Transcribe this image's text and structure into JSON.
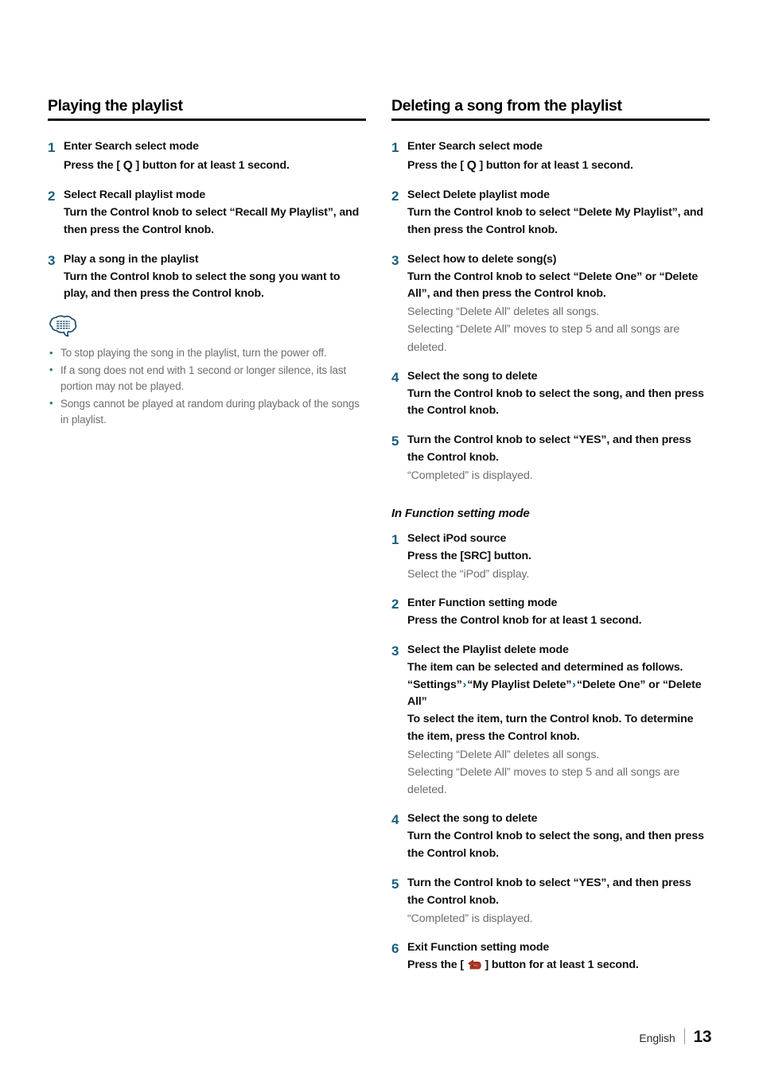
{
  "page": {
    "footer_language": "English",
    "footer_page_number": "13",
    "accent_step_color": "#1a5d7e",
    "body_text_color": "#0f0f0f",
    "muted_text_color": "#6d6e71",
    "rule_color": "#0f0f0f"
  },
  "left_column": {
    "heading": "Playing the playlist",
    "steps": [
      {
        "num": "1",
        "title": "Enter Search select mode",
        "detail_pre": "Press the [ ",
        "glyph": "search-icon",
        "glyph_char": "Q",
        "detail_post": " ] button for at least 1 second."
      },
      {
        "num": "2",
        "title": "Select Recall playlist mode",
        "detail": "Turn the Control knob to select “Recall My Playlist”, and then press the Control knob."
      },
      {
        "num": "3",
        "title": "Play a song in the playlist",
        "detail": "Turn the Control knob to select the song you want to play, and then press the Control knob."
      }
    ],
    "note": {
      "icon": "note-bubble-icon",
      "items": [
        "To stop playing the song in the playlist, turn the power off.",
        "If a song does not end with 1 second or longer silence, its last portion may not be played.",
        "Songs cannot be played at random during playback of the songs in playlist."
      ]
    }
  },
  "right_column": {
    "heading": "Deleting a song from the playlist",
    "steps": [
      {
        "num": "1",
        "title": "Enter Search select mode",
        "detail_pre": "Press the [ ",
        "glyph": "search-icon",
        "glyph_char": "Q",
        "detail_post": " ] button for at least 1 second."
      },
      {
        "num": "2",
        "title": "Select Delete playlist mode",
        "detail": "Turn the Control knob to select “Delete My Playlist”, and then press the Control knob."
      },
      {
        "num": "3",
        "title": "Select how to delete song(s)",
        "detail": "Turn the Control knob to select “Delete One” or “Delete All”, and then press the Control knob.",
        "note_lines": [
          "Selecting “Delete All” deletes all songs.",
          "Selecting “Delete All” moves to step 5 and all songs are deleted."
        ]
      },
      {
        "num": "4",
        "title": "Select the song to delete",
        "detail": "Turn the Control knob to select the song, and then press the Control knob."
      },
      {
        "num": "5",
        "title": "Turn the Control knob to select “YES”, and then press the Control knob.",
        "note_lines": [
          "“Completed” is displayed."
        ]
      }
    ],
    "subheading": "In Function setting mode",
    "function_steps": [
      {
        "num": "1",
        "title": "Select iPod source",
        "detail": "Press the [SRC] button.",
        "note_lines": [
          "Select the “iPod” display."
        ]
      },
      {
        "num": "2",
        "title": "Enter Function setting mode",
        "detail": "Press the Control knob for at least 1 second."
      },
      {
        "num": "3",
        "title": "Select the Playlist delete mode",
        "detail": "The item can be selected and determined as follows.",
        "path_prefix": "“Settings”",
        "path_arrow": "›",
        "path_mid": "“My Playlist Delete”",
        "path_suffix": "“Delete One” or “Delete All”",
        "detail2": "To select the item, turn the Control knob. To determine the item, press the Control knob.",
        "note_lines": [
          "Selecting “Delete All” deletes all songs.",
          "Selecting “Delete All” moves to step 5 and all songs are deleted."
        ]
      },
      {
        "num": "4",
        "title": "Select the song to delete",
        "detail": "Turn the Control knob to select the song, and then press the Control knob."
      },
      {
        "num": "5",
        "title": "Turn the Control knob to select “YES”, and then press the Control knob.",
        "note_lines": [
          "“Completed” is displayed."
        ]
      },
      {
        "num": "6",
        "title": "Exit Function setting mode",
        "detail_pre": "Press the [ ",
        "glyph": "return-arrow-icon",
        "detail_post": " ] button for at least 1 second."
      }
    ]
  }
}
